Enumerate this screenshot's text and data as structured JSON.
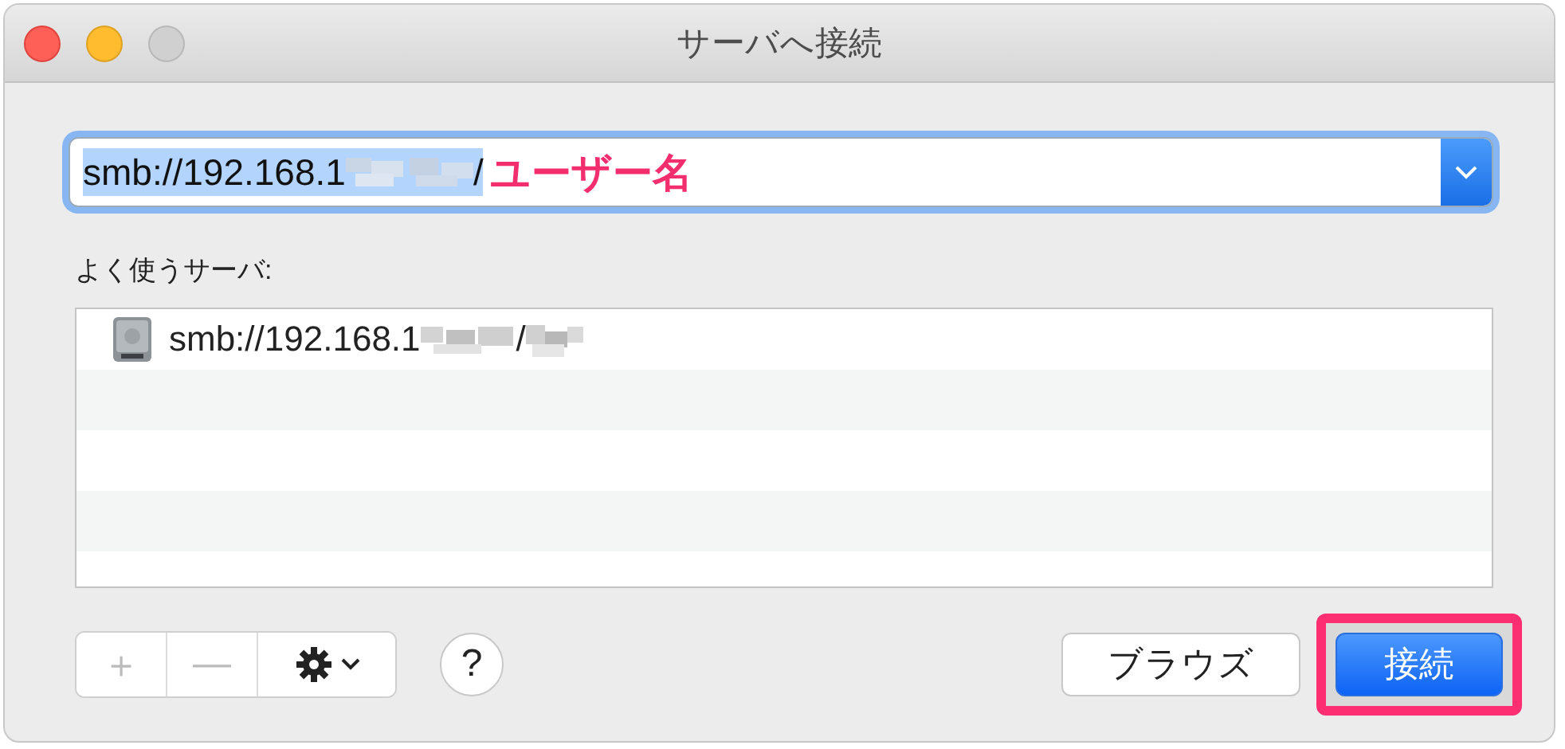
{
  "window": {
    "title": "サーバへ接続",
    "controls": [
      {
        "kind": "close",
        "disabled": false
      },
      {
        "kind": "minimize",
        "disabled": false
      },
      {
        "kind": "zoom",
        "disabled": true
      }
    ]
  },
  "address": {
    "text_start": "smb://192.168.1",
    "text_middle": "/",
    "selected": true,
    "annotation": "ユーザー名"
  },
  "favorites": {
    "label": "よく使うサーバ:",
    "rows": [
      {
        "text_start": "smb://192.168.1",
        "text_middle": "/"
      }
    ]
  },
  "toolbar": [
    {
      "kind": "add",
      "label": "＋"
    },
    {
      "kind": "remove",
      "label": "—"
    },
    {
      "kind": "action"
    }
  ],
  "help": "?",
  "buttons": [
    {
      "label": "ブラウズ",
      "default": false,
      "highlighted": false
    },
    {
      "label": "接続",
      "default": true,
      "highlighted": true
    }
  ]
}
